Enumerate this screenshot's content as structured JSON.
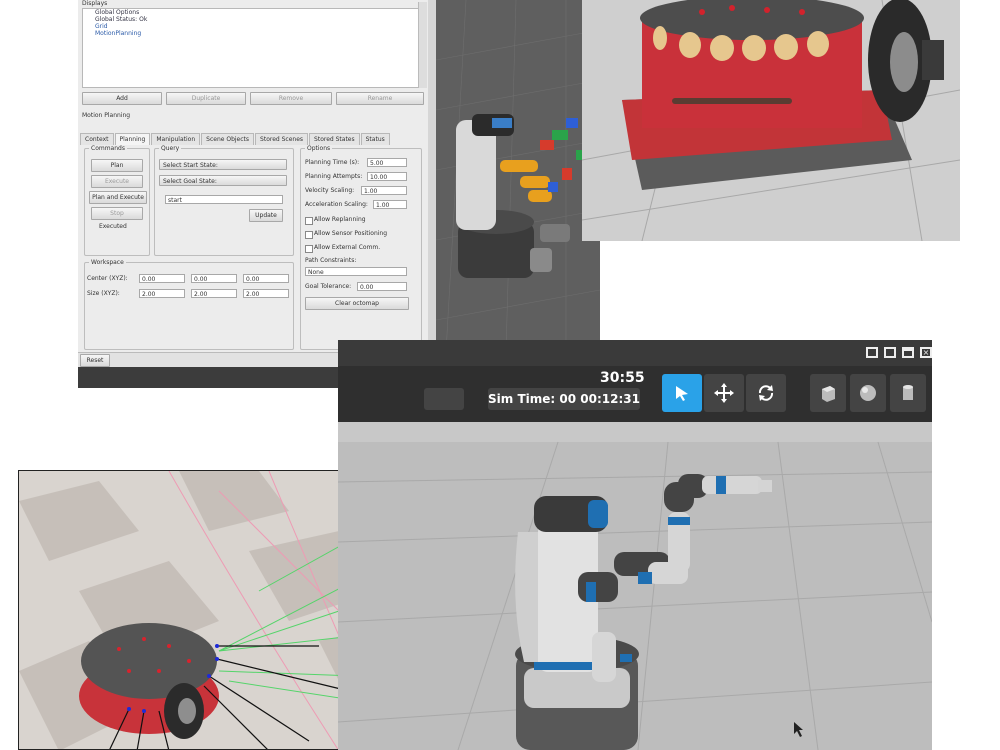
{
  "rviz": {
    "displays_title": "Displays",
    "tree_items": [
      "Global Options",
      "Global Status: Ok",
      "Grid",
      "MotionPlanning"
    ],
    "display_buttons": [
      "Add",
      "Duplicate",
      "Remove",
      "Rename"
    ],
    "panel_title": "Motion Planning",
    "tabs": [
      "Context",
      "Planning",
      "Manipulation",
      "Scene Objects",
      "Stored Scenes",
      "Stored States",
      "Status"
    ],
    "commands": {
      "title": "Commands",
      "plan": "Plan",
      "execute": "Execute",
      "plan_execute": "Plan and Execute",
      "stop": "Stop",
      "status": "Executed"
    },
    "query": {
      "title": "Query",
      "select_start": "Select Start State:",
      "select_goal": "Select Goal State:",
      "state_value": "start",
      "update": "Update"
    },
    "options": {
      "title": "Options",
      "planning_time_label": "Planning Time (s):",
      "planning_time": "5.00",
      "planning_attempts_label": "Planning Attempts:",
      "planning_attempts": "10.00",
      "velocity_label": "Velocity Scaling:",
      "velocity": "1.00",
      "accel_label": "Acceleration Scaling:",
      "accel": "1.00",
      "allow_replanning": "Allow Replanning",
      "allow_sensor": "Allow Sensor Positioning",
      "allow_external": "Allow External Comm.",
      "path_constraints_label": "Path Constraints:",
      "path_constraints": "None",
      "goal_tolerance_label": "Goal Tolerance:",
      "goal_tolerance": "0.00",
      "clear_octomap": "Clear octomap"
    },
    "workspace": {
      "title": "Workspace",
      "center_label": "Center (XYZ):",
      "center": [
        "0.00",
        "0.00",
        "0.00"
      ],
      "size_label": "Size (XYZ):",
      "size": [
        "2.00",
        "2.00",
        "2.00"
      ]
    },
    "reset": "Reset"
  },
  "gazebo": {
    "real_time": "30:55",
    "sim_time": "Sim Time: 00 00:12:31",
    "tools": [
      "select-arrow-icon",
      "translate-icon",
      "rotate-icon"
    ],
    "shapes": [
      "box-icon",
      "sphere-icon",
      "cylinder-icon"
    ],
    "colors": {
      "active_tool": "#2aa2e8",
      "toolbar_bg": "#2f2f2f"
    }
  },
  "colors": {
    "robot_red": "#d8343a",
    "fetch_blue": "#1f6fb2",
    "fetch_gray": "#606060",
    "floor": "#b8b8b8"
  }
}
